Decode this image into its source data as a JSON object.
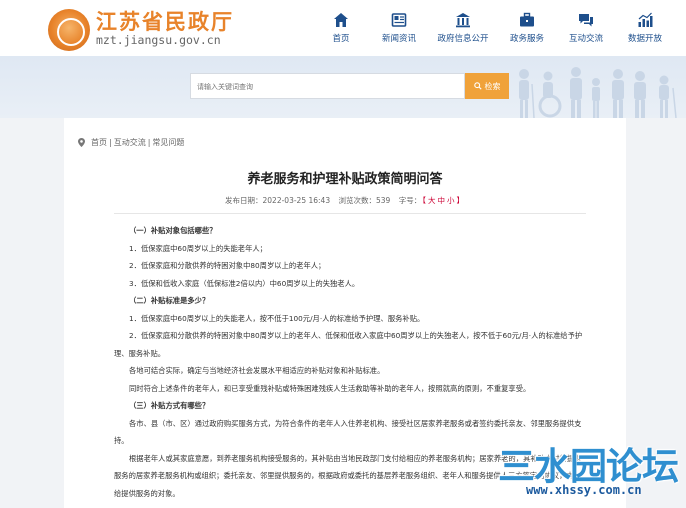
{
  "header": {
    "site_title": "江苏省民政厅",
    "site_domain": "mzt.jiangsu.gov.cn",
    "nav": [
      {
        "label": "首页",
        "icon": "home-icon"
      },
      {
        "label": "新闻资讯",
        "icon": "news-icon"
      },
      {
        "label": "政府信息公开",
        "icon": "building-icon"
      },
      {
        "label": "政务服务",
        "icon": "briefcase-icon"
      },
      {
        "label": "互动交流",
        "icon": "chat-icon"
      },
      {
        "label": "数据开放",
        "icon": "bar-chart-icon"
      }
    ]
  },
  "search": {
    "placeholder": "请输入关键词查询",
    "button_label": "检索"
  },
  "breadcrumb": {
    "items": [
      "首页",
      "互动交流",
      "常见问题"
    ],
    "separator": "|"
  },
  "article": {
    "title": "养老服务和护理补贴政策简明问答",
    "meta": {
      "publish_label": "发布日期：",
      "publish_date": "2022-03-25 16:43",
      "views_label": "浏览次数：",
      "views": "539",
      "fontsize_label": "字号：",
      "fontsize_open": "【",
      "fontsize_big": "大",
      "fontsize_mid": "中",
      "fontsize_small": "小",
      "fontsize_close": "】"
    },
    "paragraphs": [
      {
        "style": "head",
        "text": "（一）补贴对象包括哪些？"
      },
      {
        "style": "sub",
        "text": "1．低保家庭中60周岁以上的失能老年人；"
      },
      {
        "style": "sub",
        "text": "2．低保家庭和分散供养的特困对象中80周岁以上的老年人；"
      },
      {
        "style": "sub",
        "text": "3．低保和低收入家庭（低保标准2倍以内）中60周岁以上的失独老人。"
      },
      {
        "style": "head",
        "text": "（二）补贴标准是多少？"
      },
      {
        "style": "sub",
        "text": "1．低保家庭中60周岁以上的失能老人，按不低于100元/月·人的标准给予护理、服务补贴。"
      },
      {
        "style": "indent",
        "text": "2．低保家庭和分散供养的特困对象中80周岁以上的老年人、低保和低收入家庭中60周岁以上的失独老人，按不低于60元/月·人的标准给予护理、服务补贴。"
      },
      {
        "style": "sub",
        "text": "各地可结合实际，确定与当地经济社会发展水平相适应的补贴对象和补贴标准。"
      },
      {
        "style": "sub",
        "text": "同时符合上述条件的老年人，和已享受重残补贴或特殊困难残疾人生活救助等补助的老年人，按照就高的原则，不重复享受。"
      },
      {
        "style": "head",
        "text": "（三）补贴方式有哪些？"
      },
      {
        "style": "indent",
        "text": "各市、县（市、区）通过政府购买服务方式，为符合条件的老年人入住养老机构、接受社区居家养老服务或者签约委托亲友、邻里服务提供支持。"
      },
      {
        "style": "indent",
        "text": "根据老年人或其家庭意愿，到养老服务机构接受服务的，其补贴由当地民政部门支付给相应的养老服务机构；居家养老的，其补贴支付给提供服务的居家养老服务机构或组织；委托亲友、邻里提供服务的，根据政府或委托的基层养老服务组织、老年人和服务提供人三方签定的协议，支付给提供服务的对象。"
      }
    ]
  },
  "watermark": {
    "text": "三水园论坛",
    "url": "www.xhssy.com.cn"
  },
  "colors": {
    "brand_orange": "#e8832a",
    "nav_blue": "#1e4f8c",
    "search_button": "#f0a23a",
    "watermark_blue": "#2f8fd0"
  }
}
